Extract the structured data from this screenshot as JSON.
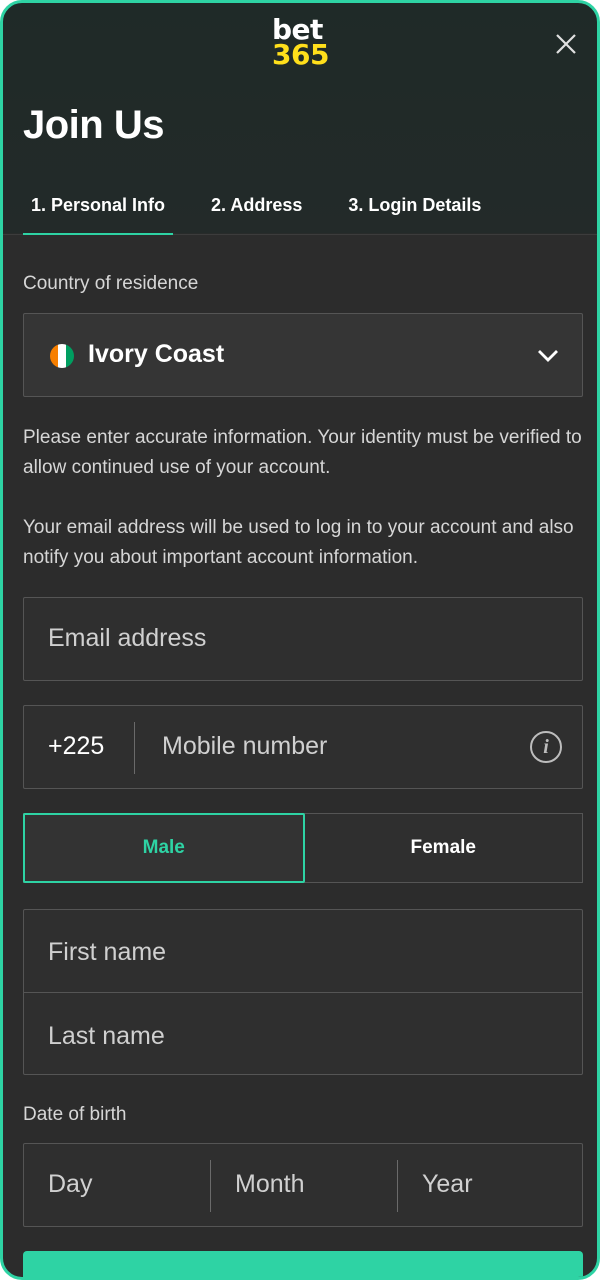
{
  "header": {
    "logo_top": "bet",
    "logo_bottom": "365",
    "title": "Join Us"
  },
  "tabs": [
    {
      "label": "1.  Personal Info",
      "active": true
    },
    {
      "label": "2.  Address",
      "active": false
    },
    {
      "label": "3.  Login Details",
      "active": false
    }
  ],
  "country": {
    "label": "Country of residence",
    "value": "Ivory Coast",
    "flag_colors": [
      "#f77f00",
      "#ffffff",
      "#009e60"
    ]
  },
  "info_text_1": "Please enter accurate information. Your identity must be verified to allow continued use of your account.",
  "info_text_2": "Your email address will be used to log in to your account and also notify you about important account information.",
  "email": {
    "placeholder": "Email address"
  },
  "mobile": {
    "prefix": "+225",
    "placeholder": "Mobile number",
    "info_icon": "i"
  },
  "gender": {
    "options": [
      "Male",
      "Female"
    ],
    "selected": "Male"
  },
  "first_name": {
    "placeholder": "First name"
  },
  "last_name": {
    "placeholder": "Last name"
  },
  "dob": {
    "label": "Date of birth",
    "day": "Day",
    "month": "Month",
    "year": "Year"
  },
  "colors": {
    "accent": "#2ed3a4",
    "brand_yellow": "#ffdf1b",
    "background": "#2c2c2c"
  }
}
